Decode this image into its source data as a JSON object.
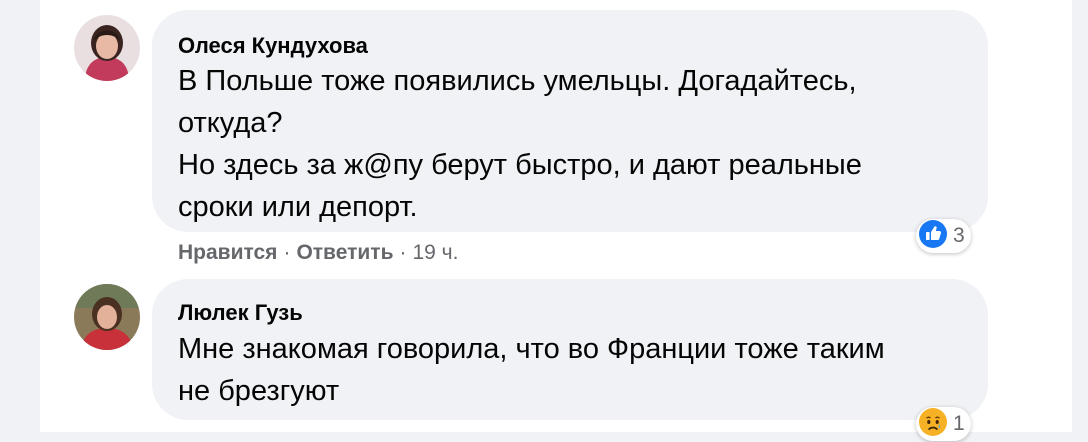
{
  "comments": [
    {
      "author": "Олеся Кундухова",
      "lines": [
        "В Польше тоже появились умельцы. Догадайтесь,",
        "откуда?",
        "Но здесь за ж@пу берут быстро, и дают реальные",
        "сроки или депорт."
      ],
      "actions": {
        "like": "Нравится",
        "dot1": "·",
        "reply": "Ответить",
        "dot2": "·",
        "time": "19 ч."
      },
      "reaction": {
        "icon": "like-icon",
        "count": "3",
        "color": "#1877f2"
      }
    },
    {
      "author": "Люлек Гузь",
      "lines": [
        "Мне знакомая говорила, что во Франции тоже таким",
        "не брезгуют"
      ],
      "reaction": {
        "icon": "sad-icon",
        "count": "1",
        "color": "#f7b125"
      }
    }
  ]
}
